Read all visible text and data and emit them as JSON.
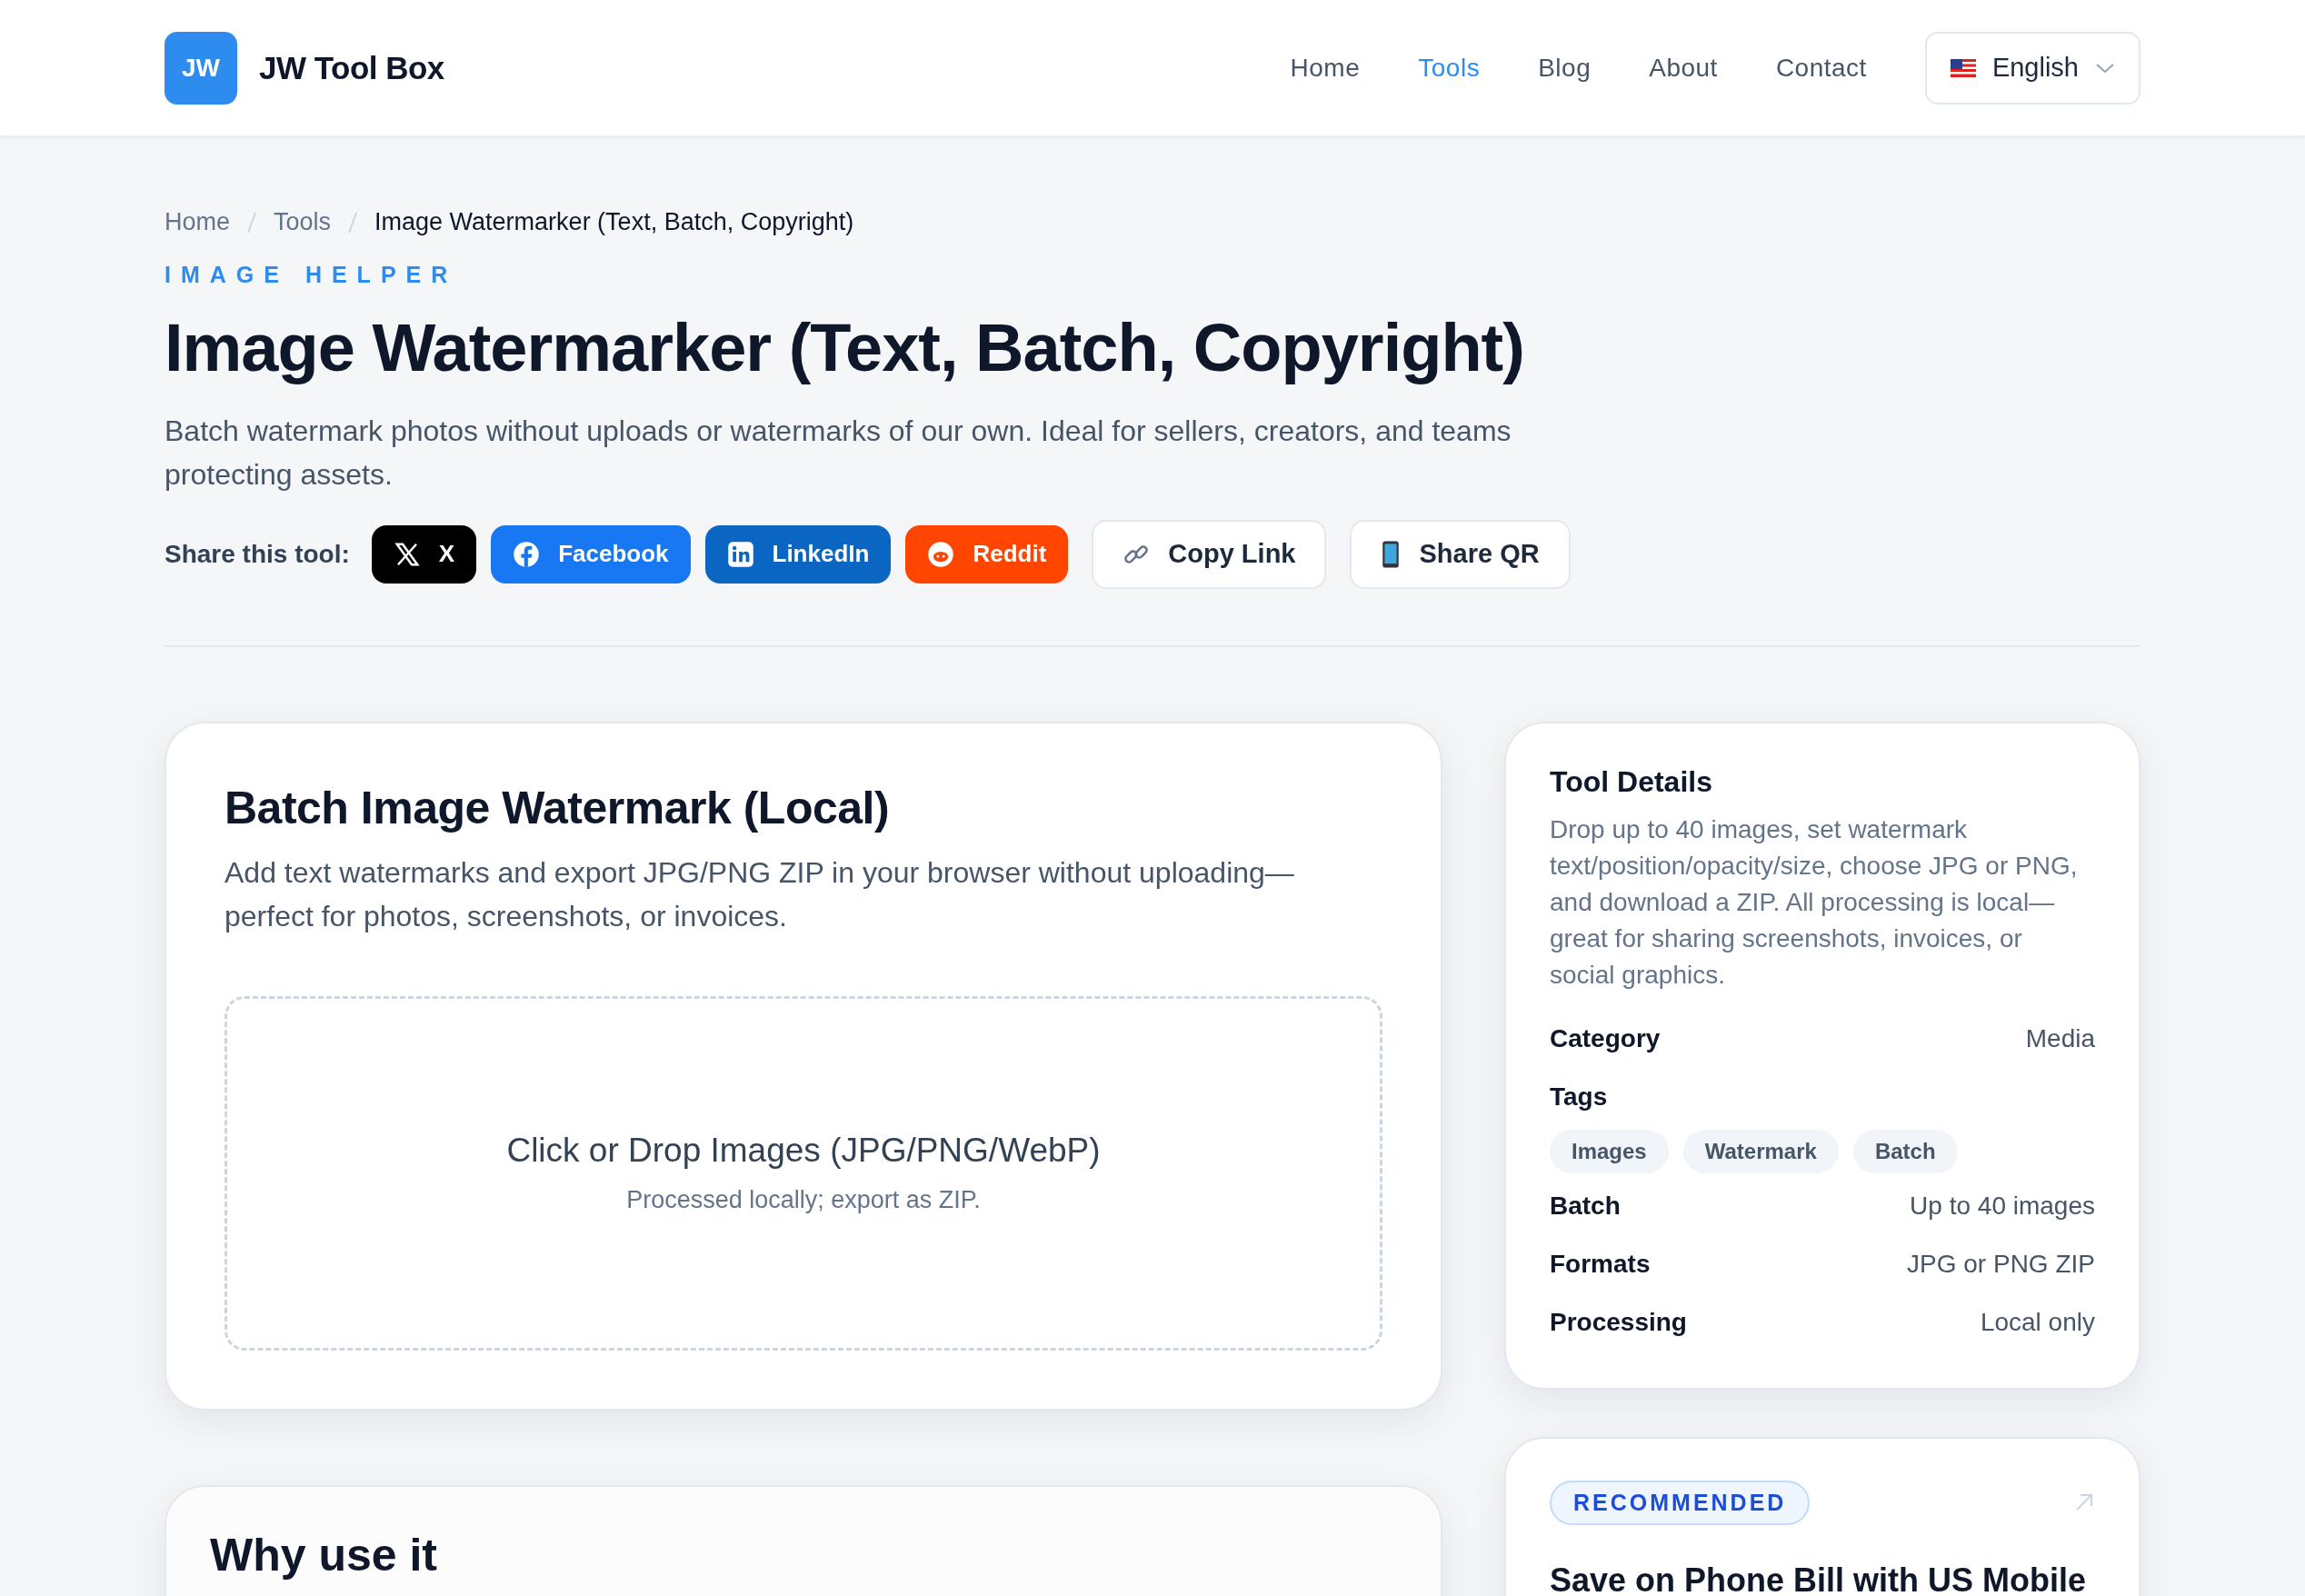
{
  "header": {
    "logo_badge": "JW",
    "brand": "JW Tool Box",
    "nav": [
      {
        "label": "Home",
        "selected": false
      },
      {
        "label": "Tools",
        "selected": true
      },
      {
        "label": "Blog",
        "selected": false
      },
      {
        "label": "About",
        "selected": false
      },
      {
        "label": "Contact",
        "selected": false
      }
    ],
    "language": "English"
  },
  "breadcrumb": [
    "Home",
    "Tools",
    "Image Watermarker (Text, Batch, Copyright)"
  ],
  "eyebrow": "IMAGE HELPER",
  "title": "Image Watermarker (Text, Batch, Copyright)",
  "description": "Batch watermark photos without uploads or watermarks of our own. Ideal for sellers, creators, and teams protecting assets.",
  "share": {
    "label": "Share this tool:",
    "buttons": [
      {
        "kind": "x",
        "label": "X"
      },
      {
        "kind": "facebook",
        "label": "Facebook"
      },
      {
        "kind": "linkedin",
        "label": "LinkedIn"
      },
      {
        "kind": "reddit",
        "label": "Reddit"
      },
      {
        "kind": "copy",
        "label": "Copy Link"
      },
      {
        "kind": "qr",
        "label": "Share QR"
      }
    ]
  },
  "tool_card": {
    "title": "Batch Image Watermark (Local)",
    "description": "Add text watermarks and export JPG/PNG ZIP in your browser without uploading—perfect for photos, screenshots, or invoices.",
    "dropzone": {
      "title": "Click or Drop Images (JPG/PNG/WebP)",
      "hint": "Processed locally; export as ZIP."
    }
  },
  "details": {
    "title": "Tool Details",
    "description": "Drop up to 40 images, set watermark text/position/opacity/size, choose JPG or PNG, and download a ZIP. All processing is local—great for sharing screenshots, invoices, or social graphics.",
    "rows": [
      {
        "kind": "value",
        "label": "Category",
        "value": "Media"
      },
      {
        "kind": "tags",
        "label": "Tags",
        "tags": [
          "Images",
          "Watermark",
          "Batch"
        ]
      },
      {
        "kind": "value",
        "label": "Batch",
        "value": "Up to 40 images"
      },
      {
        "kind": "value",
        "label": "Formats",
        "value": "JPG or PNG ZIP"
      },
      {
        "kind": "value",
        "label": "Processing",
        "value": "Local only"
      }
    ]
  },
  "why_card": {
    "title": "Why use it"
  },
  "recommended": {
    "badge": "RECOMMENDED",
    "title": "Save on Phone Bill with US Mobile"
  }
}
